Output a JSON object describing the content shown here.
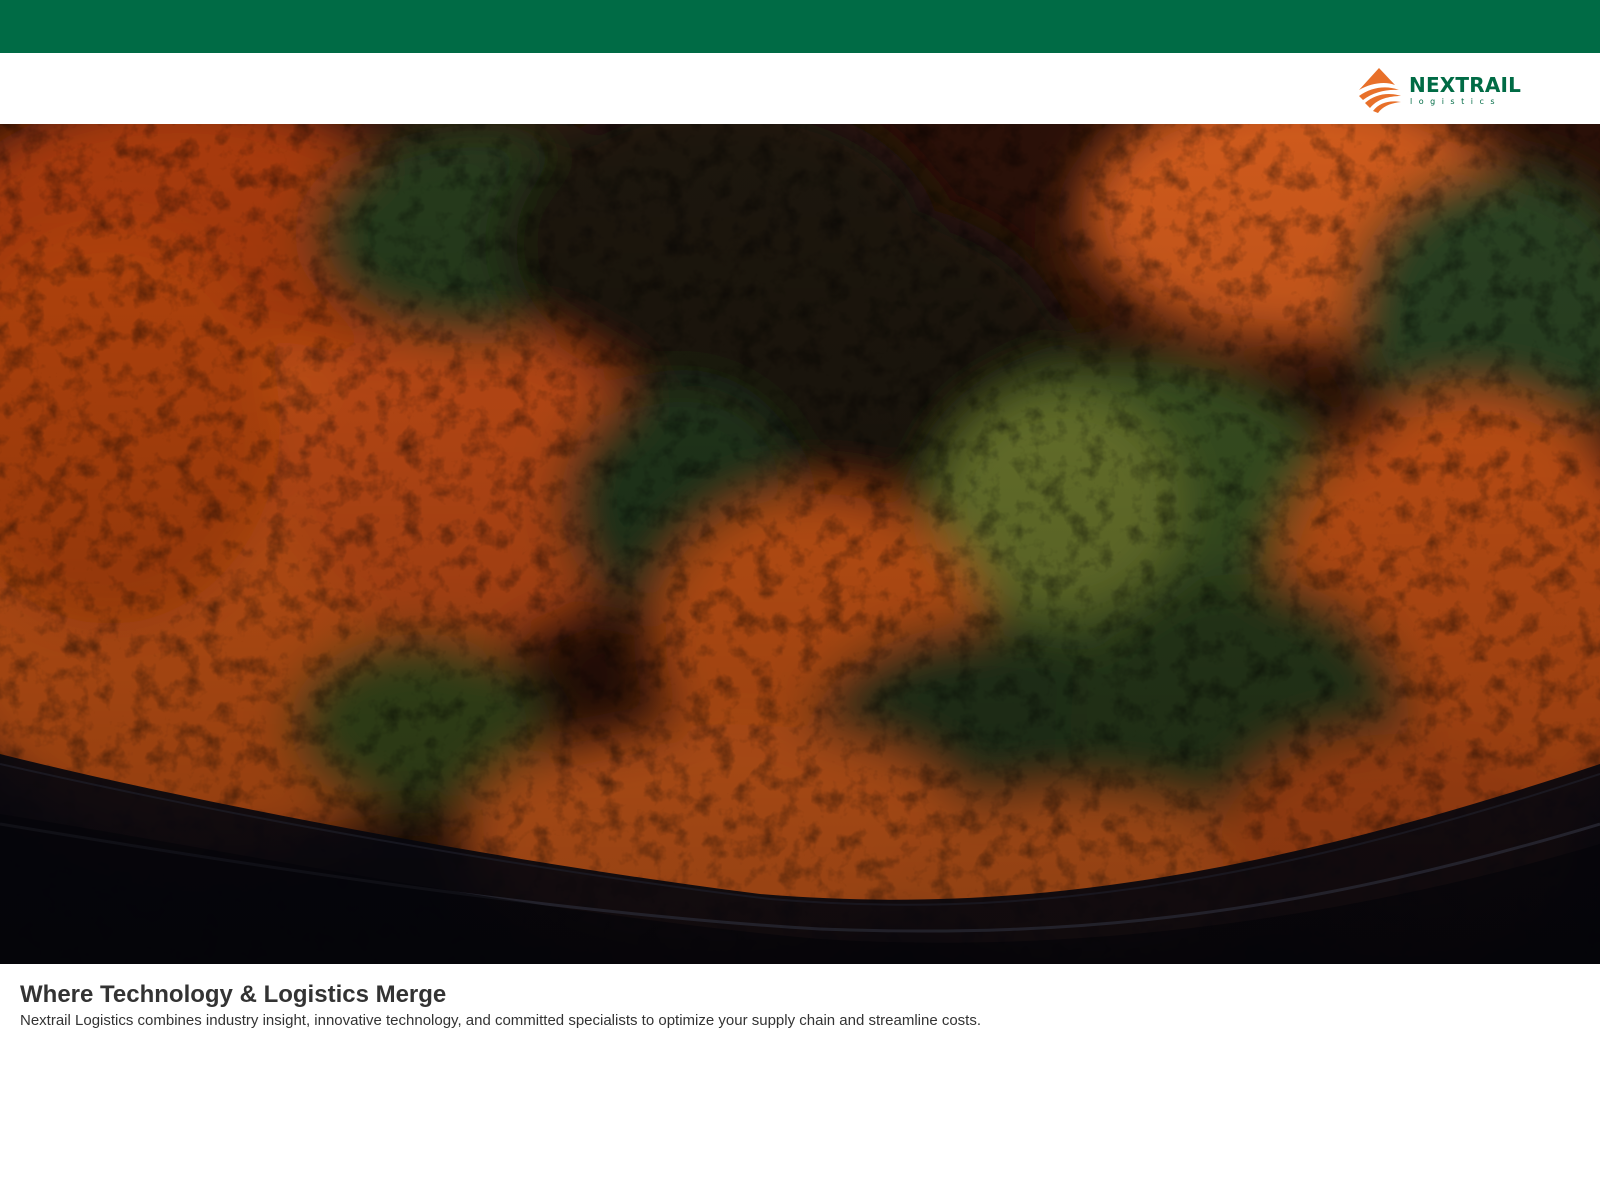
{
  "brand": {
    "name": "NEXTRAIL",
    "tagline": "logistics",
    "colors": {
      "primary_green": "#006b45",
      "accent_orange": "#e8702a",
      "text_dark": "#333333"
    }
  },
  "header": {
    "logo_icon": "nextrail-wave-logo-icon"
  },
  "hero": {
    "image_subject": "aerial-autumn-forest-road",
    "media_type": "video-background"
  },
  "content": {
    "headline": "Where Technology & Logistics Merge",
    "description": "Nextrail Logistics combines industry insight, innovative technology, and committed specialists to optimize your supply chain and streamline costs."
  }
}
